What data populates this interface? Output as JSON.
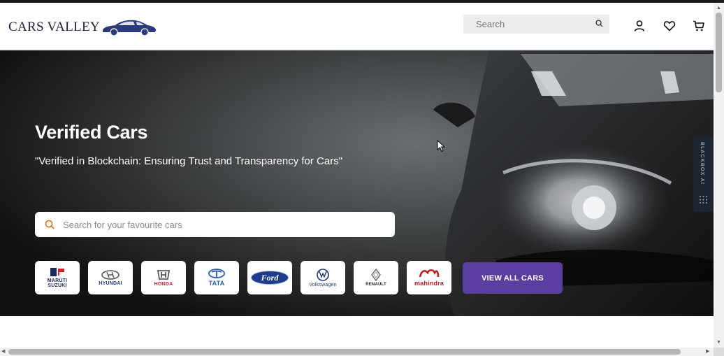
{
  "header": {
    "logo_text": "CARS VALLEY",
    "search_placeholder": "Search"
  },
  "hero": {
    "title": "Verified Cars",
    "subtitle": "\"Verified in Blockchain: Ensuring Trust and Transparency for Cars\"",
    "search_placeholder": "Search for your favourite cars",
    "view_all_label": "VIEW ALL CARS"
  },
  "brands": [
    {
      "name": "MARUTI SUZUKI",
      "line1": "MARUTI",
      "line2": "SUZUKI",
      "color": "#1b2a5e"
    },
    {
      "name": "HYUNDAI",
      "line1": "HYUNDAI",
      "line2": "",
      "color": "#1f3f7a"
    },
    {
      "name": "HONDA",
      "line1": "HONDA",
      "line2": "",
      "color": "#d0232a"
    },
    {
      "name": "TATA",
      "line1": "TATA",
      "line2": "",
      "color": "#2b5aa6"
    },
    {
      "name": "Ford",
      "line1": "Ford",
      "line2": "",
      "color": "#1d3c8c"
    },
    {
      "name": "Volkswagen",
      "line1": "Volkswagen",
      "line2": "",
      "color": "#1d3a6e"
    },
    {
      "name": "RENAULT",
      "line1": "RENAULT",
      "line2": "",
      "color": "#222222"
    },
    {
      "name": "Mahindra",
      "line1": "mahindra",
      "line2": "",
      "color": "#c41a22"
    }
  ],
  "sidebar_tab": {
    "label": "BLACKBOX AI"
  },
  "colors": {
    "accent": "#5b3fa0",
    "logo_navy": "#1c1f3a",
    "search_icon_orange": "#d07a2a"
  },
  "icons": [
    "search-icon",
    "user-icon",
    "heart-icon",
    "cart-icon",
    "car-logo-icon"
  ]
}
